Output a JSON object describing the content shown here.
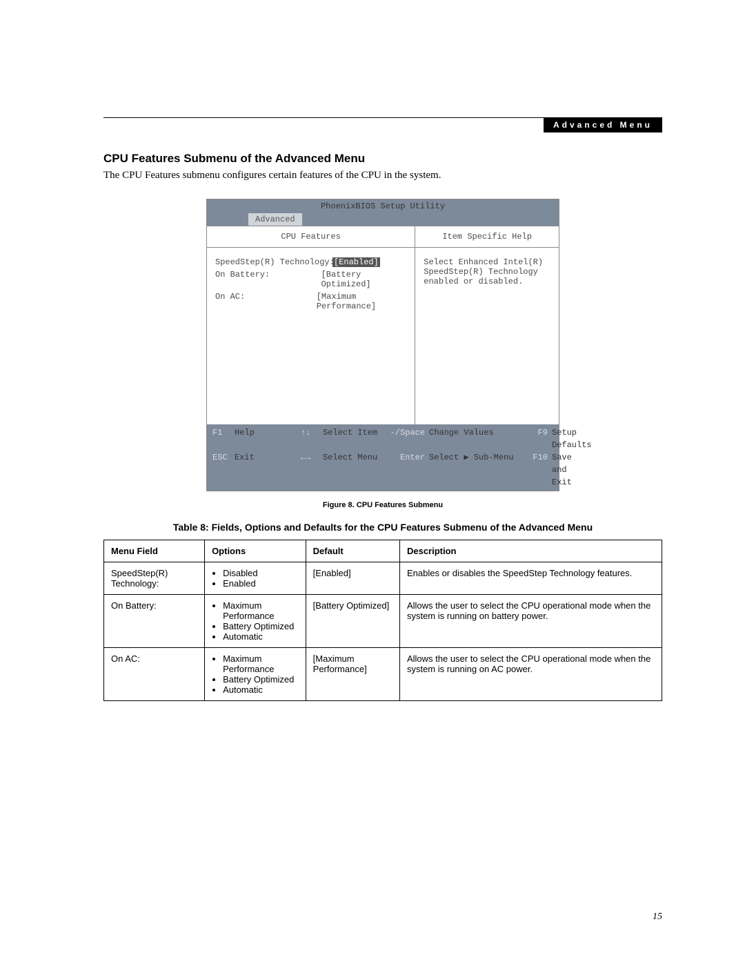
{
  "header": {
    "badge": "Advanced Menu"
  },
  "h": "CPU Features Submenu of the Advanced Menu",
  "intro": "The CPU Features submenu configures certain features of the CPU in the system.",
  "bios": {
    "title": "PhoenixBIOS Setup Utility",
    "tab": "Advanced",
    "left_head": "CPU Features",
    "right_head": "Item Specific Help",
    "rows": [
      {
        "label": "SpeedStep(R) Technology:",
        "value": "[Enabled]",
        "selected": true
      },
      {
        "label": "  On Battery:",
        "value": "[Battery Optimized]",
        "selected": false
      },
      {
        "label": "  On AC:",
        "value": "[Maximum Performance]",
        "selected": false
      }
    ],
    "help": "Select Enhanced Intel(R) SpeedStep(R) Technology enabled or disabled.",
    "footer": [
      [
        {
          "k": "F1",
          "t": "Help"
        },
        {
          "k": "↑↓",
          "t": "Select Item"
        },
        {
          "k": "-/Space",
          "t": "Change Values"
        },
        {
          "k": "F9",
          "t": "Setup Defaults"
        }
      ],
      [
        {
          "k": "ESC",
          "t": "Exit"
        },
        {
          "k": "←→",
          "t": "Select Menu"
        },
        {
          "k": "Enter",
          "t": "Select ▶ Sub-Menu"
        },
        {
          "k": "F10",
          "t": "Save and Exit"
        }
      ]
    ]
  },
  "figcap": "Figure 8.  CPU Features Submenu",
  "tabcap": "Table 8: Fields, Options and Defaults for the CPU Features Submenu of the Advanced Menu",
  "table": {
    "headers": [
      "Menu Field",
      "Options",
      "Default",
      "Description"
    ],
    "rows": [
      {
        "field": "SpeedStep(R) Technology:",
        "opts": [
          "Disabled",
          "Enabled"
        ],
        "def": "[Enabled]",
        "desc": "Enables or disables the SpeedStep Technology features."
      },
      {
        "field": "On Battery:",
        "opts": [
          "Maximum Performance",
          "Battery Optimized",
          "Automatic"
        ],
        "def": "[Battery Optimized]",
        "desc": "Allows the user to select the CPU operational mode when the system is running on battery power."
      },
      {
        "field": "On AC:",
        "opts": [
          "Maximum Performance",
          "Battery Optimized",
          "Automatic"
        ],
        "def": "[Maximum Performance]",
        "desc": "Allows the user to select the CPU operational mode when the system is running on AC power."
      }
    ]
  },
  "pagenum": "15"
}
